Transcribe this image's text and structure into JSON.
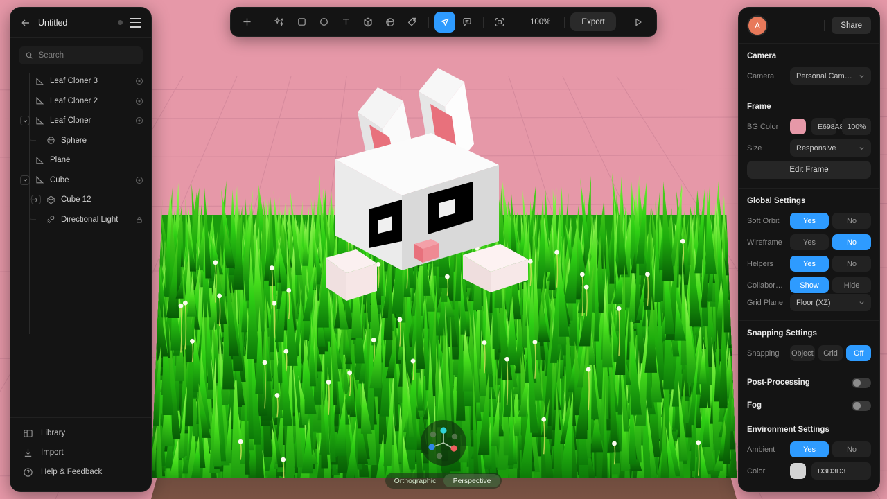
{
  "scene": {
    "bg_color": "#e698a8",
    "grass_color": "#22c312",
    "grass_color_dark": "#0f8a0a",
    "grass_color_light": "#6ee832",
    "dirt_color": "#6b4a3c",
    "bunny_body_color": "#ffffff",
    "bunny_shade_color": "#d9d9d9",
    "bunny_ear_inner_color": "#e8717c",
    "bunny_nose_color": "#ef8a93",
    "bunny_eye_color": "#000000",
    "grid_line_color": "#d2879a",
    "accent_color": "#2e9bff"
  },
  "sidebar": {
    "back_icon": "arrow-left-icon",
    "title": "Untitled",
    "status_dot": "unsaved-dot",
    "menu_icon": "hamburger-menu-icon",
    "search": {
      "icon": "search-icon",
      "value": "",
      "placeholder": "Search"
    },
    "layers": [
      {
        "label": "Leaf Cloner 3",
        "icon": "plane-icon",
        "depth": 1,
        "twisty": "none",
        "trailing": "cloner-target-icon"
      },
      {
        "label": "Leaf Cloner 2",
        "icon": "plane-icon",
        "depth": 1,
        "twisty": "none",
        "trailing": "cloner-target-icon"
      },
      {
        "label": "Leaf Cloner",
        "icon": "plane-icon",
        "depth": 1,
        "twisty": "expanded",
        "trailing": "cloner-target-icon"
      },
      {
        "label": "Sphere",
        "icon": "sphere-icon",
        "depth": 2,
        "twisty": "none",
        "trailing": ""
      },
      {
        "label": "Plane",
        "icon": "plane-icon",
        "depth": 1,
        "twisty": "none",
        "trailing": ""
      },
      {
        "label": "Cube",
        "icon": "plane-icon",
        "depth": 1,
        "twisty": "expanded",
        "trailing": "cloner-target-icon"
      },
      {
        "label": "Cube 12",
        "icon": "cube-icon",
        "depth": 2,
        "twisty": "collapsed",
        "trailing": ""
      },
      {
        "label": "Directional Light",
        "icon": "light-icon",
        "depth": 2,
        "twisty": "none",
        "trailing": "lock-icon"
      }
    ],
    "footer": [
      {
        "label": "Library",
        "icon": "library-icon"
      },
      {
        "label": "Import",
        "icon": "import-icon"
      },
      {
        "label": "Help & Feedback",
        "icon": "help-icon"
      }
    ]
  },
  "toolbar": {
    "tools": [
      {
        "name": "add-icon",
        "active": false
      },
      {
        "name": "magic-icon",
        "active": false
      },
      {
        "name": "square-icon",
        "active": false
      },
      {
        "name": "circle-icon",
        "active": false
      },
      {
        "name": "text-icon",
        "active": false
      },
      {
        "name": "cube-icon",
        "active": false
      },
      {
        "name": "sphere-icon",
        "active": false
      },
      {
        "name": "tag-icon",
        "active": false
      },
      {
        "name": "cursor-icon",
        "active": true
      },
      {
        "name": "comment-icon",
        "active": false
      },
      {
        "name": "frame-icon",
        "active": false
      }
    ],
    "zoom_level": "100%",
    "export_label": "Export",
    "play_icon": "play-icon"
  },
  "right_panel": {
    "avatar_initial": "A",
    "share_label": "Share",
    "camera": {
      "title": "Camera",
      "camera_label": "Camera",
      "camera_value": "Personal Camera"
    },
    "frame": {
      "title": "Frame",
      "bg_color_label": "BG Color",
      "bg_color_hex": "E698A8",
      "bg_color_swatch": "#e698a8",
      "bg_opacity": "100%",
      "size_label": "Size",
      "size_value": "Responsive",
      "edit_frame_label": "Edit Frame"
    },
    "global_settings": {
      "title": "Global Settings",
      "rows": [
        {
          "label": "Soft Orbit",
          "options": [
            "Yes",
            "No"
          ],
          "selected": "Yes"
        },
        {
          "label": "Wireframe",
          "options": [
            "Yes",
            "No"
          ],
          "selected": "No"
        },
        {
          "label": "Helpers",
          "options": [
            "Yes",
            "No"
          ],
          "selected": "Yes"
        },
        {
          "label": "Collabora…",
          "options": [
            "Show",
            "Hide"
          ],
          "selected": "Show"
        }
      ],
      "grid_plane_label": "Grid Plane",
      "grid_plane_value": "Floor (XZ)"
    },
    "snapping_settings": {
      "title": "Snapping Settings",
      "label": "Snapping",
      "options": [
        "Object",
        "Grid",
        "Off"
      ],
      "selected": "Off"
    },
    "post_processing": {
      "label": "Post-Processing",
      "enabled": false
    },
    "fog": {
      "label": "Fog",
      "enabled": false
    },
    "environment_settings": {
      "title": "Environment Settings",
      "ambient_label": "Ambient",
      "ambient_options": [
        "Yes",
        "No"
      ],
      "ambient_selected": "Yes",
      "color_label": "Color",
      "color_hex": "D3D3D3",
      "color_swatch": "#d3d3d3"
    }
  },
  "viewport_controls": {
    "gizmo": "axis-gizmo",
    "projection_options": [
      "Orthographic",
      "Perspective"
    ],
    "projection_selected": "Perspective"
  }
}
